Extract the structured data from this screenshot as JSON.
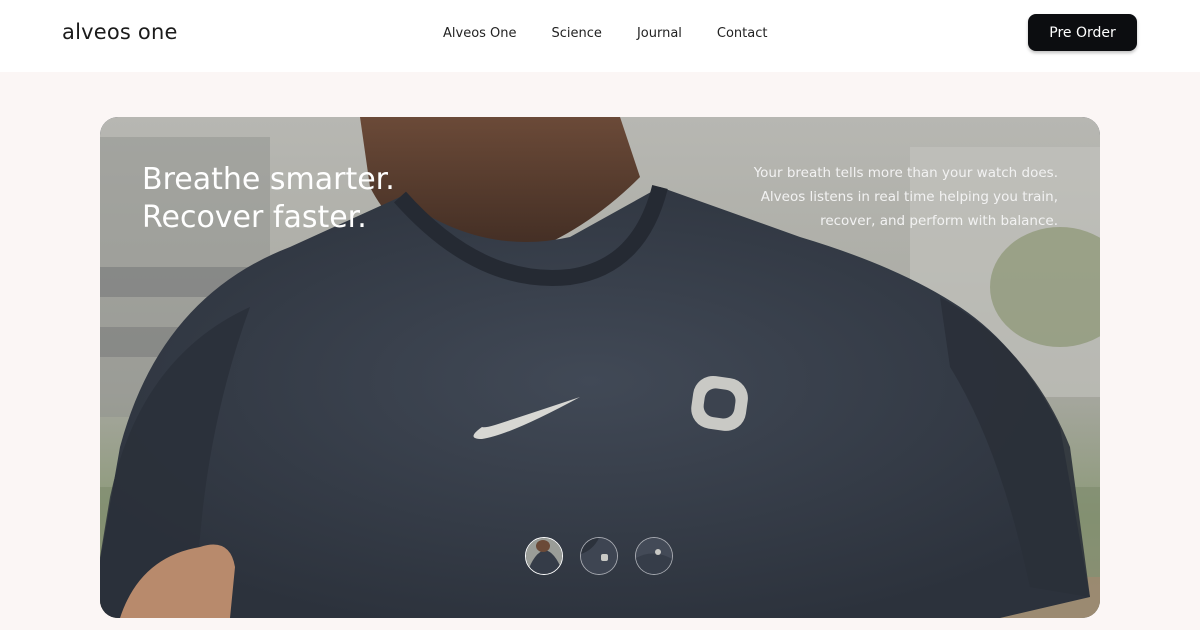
{
  "brand": {
    "name": "alveos one"
  },
  "nav": {
    "items": [
      "Alveos One",
      "Science",
      "Journal",
      "Contact"
    ],
    "cta": "Pre Order"
  },
  "hero": {
    "headline": [
      "Breathe smarter.",
      "Recover faster."
    ],
    "tagline": [
      "Your breath tells more than your watch does.",
      "Alveos listens in real time helping you train,",
      "recover, and perform with balance."
    ],
    "image": "runner wearing Alveos One breathing sensor clip on dark t-shirt",
    "carousel": {
      "slides": [
        "runner-slide-1",
        "runner-slide-2",
        "runner-slide-3"
      ],
      "active": 0
    }
  },
  "colors": {
    "background": "#fbf6f5",
    "header": "#ffffff",
    "button": "#0c0d10",
    "shirt": "#353c48"
  }
}
